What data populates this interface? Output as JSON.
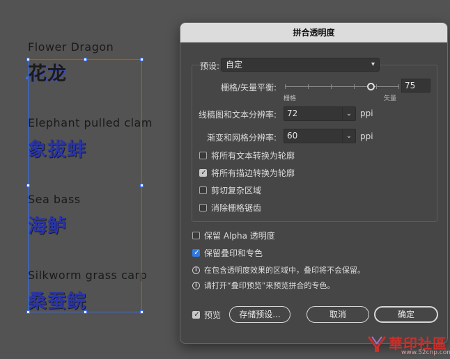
{
  "artboard": {
    "items": [
      {
        "en": "Flower Dragon",
        "cn": "花龙"
      },
      {
        "en": "Elephant pulled clam",
        "cn": "象拔蚌"
      },
      {
        "en": "Sea bass",
        "cn": "海鲈"
      },
      {
        "en": "Silkworm grass carp",
        "cn": "桑蚕鲩"
      }
    ]
  },
  "dialog": {
    "title": "拼合透明度",
    "preset_label": "预设:",
    "preset_value": "自定",
    "balance_label": "栅格/矢量平衡:",
    "balance_left": "栅格",
    "balance_right": "矢量",
    "balance_value": "75",
    "line_art_label": "线稿图和文本分辨率:",
    "line_art_value": "72",
    "line_art_unit": "ppi",
    "gradient_label": "渐变和网格分辨率:",
    "gradient_value": "60",
    "gradient_unit": "ppi",
    "checkboxes": [
      {
        "label": "将所有文本转换为轮廓",
        "checked": false
      },
      {
        "label": "将所有描边转换为轮廓",
        "checked": true
      },
      {
        "label": "剪切复杂区域",
        "checked": false
      },
      {
        "label": "消除栅格锯齿",
        "checked": false
      }
    ],
    "preserve_alpha_label": "保留 Alpha 透明度",
    "preserve_alpha_checked": false,
    "preserve_overprint_label": "保留叠印和专色",
    "preserve_overprint_checked": true,
    "info_1": "在包含透明度效果的区域中，叠印将不会保留。",
    "info_2": "请打开“叠印预览”来预览拼合的专色。",
    "preview_label": "预览",
    "preview_checked": true,
    "save_preset_label": "存储预设...",
    "cancel_label": "取消",
    "ok_label": "确定"
  },
  "watermark": {
    "text": "華印社區",
    "url": "www.52cnp.com"
  },
  "colors": {
    "canvas_bg": "#535353",
    "dialog_bg": "#464646",
    "selection_blue": "#3a6ee8",
    "checkbox_blue": "#2f7ae5"
  }
}
